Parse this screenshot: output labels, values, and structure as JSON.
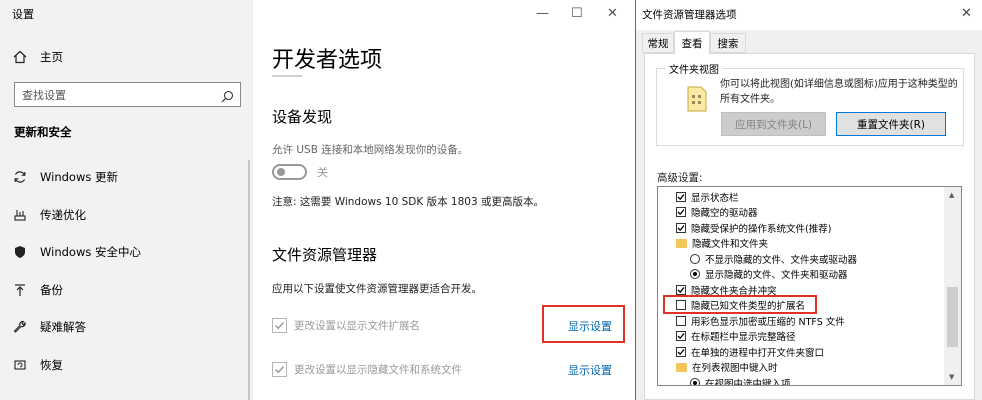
{
  "settings": {
    "title": "设置",
    "window_controls": {
      "minimize": "—",
      "maximize": "☐",
      "close": "✕"
    },
    "sidebar": {
      "home": "主页",
      "search_placeholder": "查找设置",
      "section": "更新和安全",
      "items": [
        {
          "label": "Windows 更新",
          "icon": "sync-icon"
        },
        {
          "label": "传递优化",
          "icon": "delivery-optimization-icon"
        },
        {
          "label": "Windows 安全中心",
          "icon": "shield-icon"
        },
        {
          "label": "备份",
          "icon": "backup-arrow-icon"
        },
        {
          "label": "疑难解答",
          "icon": "wrench-icon"
        },
        {
          "label": "恢复",
          "icon": "recovery-icon"
        }
      ]
    },
    "main": {
      "page_title": "开发者选项",
      "device_discovery": {
        "heading": "设备发现",
        "description": "允许 USB 连接和本地网络发现你的设备。",
        "toggle_state": "关",
        "note": "注意: 这需要 Windows 10 SDK 版本 1803 或更高版本。"
      },
      "file_explorer": {
        "heading": "文件资源管理器",
        "description": "应用以下设置使文件资源管理器更适合开发。",
        "options": [
          {
            "label": "更改设置以显示文件扩展名",
            "checked": true,
            "link": "显示设置"
          },
          {
            "label": "更改设置以显示隐藏文件和系统文件",
            "checked": true,
            "link": "显示设置"
          }
        ]
      }
    }
  },
  "dialog": {
    "title": "文件资源管理器选项",
    "close": "✕",
    "tabs": [
      "常规",
      "查看",
      "搜索"
    ],
    "active_tab": "查看",
    "folder_view": {
      "legend": "文件夹视图",
      "text": "你可以将此视图(如详细信息或图标)应用于这种类型的所有文件夹。",
      "apply_button": "应用到文件夹(L)",
      "reset_button": "重置文件夹(R)"
    },
    "advanced_label": "高级设置:",
    "advanced_items": [
      {
        "type": "check",
        "checked": true,
        "label": "显示状态栏",
        "indent": 1
      },
      {
        "type": "check",
        "checked": true,
        "label": "隐藏空的驱动器",
        "indent": 1
      },
      {
        "type": "check",
        "checked": true,
        "label": "隐藏受保护的操作系统文件(推荐)",
        "indent": 1
      },
      {
        "type": "folder",
        "label": "隐藏文件和文件夹",
        "indent": 1
      },
      {
        "type": "radio",
        "checked": false,
        "label": "不显示隐藏的文件、文件夹或驱动器",
        "indent": 2
      },
      {
        "type": "radio",
        "checked": true,
        "label": "显示隐藏的文件、文件夹和驱动器",
        "indent": 2
      },
      {
        "type": "check",
        "checked": true,
        "label": "隐藏文件夹合并冲突",
        "indent": 1
      },
      {
        "type": "check",
        "checked": false,
        "label": "隐藏已知文件类型的扩展名",
        "indent": 1
      },
      {
        "type": "check",
        "checked": false,
        "label": "用彩色显示加密或压缩的 NTFS 文件",
        "indent": 1
      },
      {
        "type": "check",
        "checked": true,
        "label": "在标题栏中显示完整路径",
        "indent": 1
      },
      {
        "type": "check",
        "checked": true,
        "label": "在单独的进程中打开文件夹窗口",
        "indent": 1
      },
      {
        "type": "folder",
        "label": "在列表视图中键入时",
        "indent": 1
      },
      {
        "type": "radio",
        "checked": true,
        "label": "在视图中选中键入项",
        "indent": 2
      }
    ]
  },
  "colors": {
    "highlight": "#e0302a",
    "link": "#0066b4",
    "accent": "#0078d7"
  }
}
